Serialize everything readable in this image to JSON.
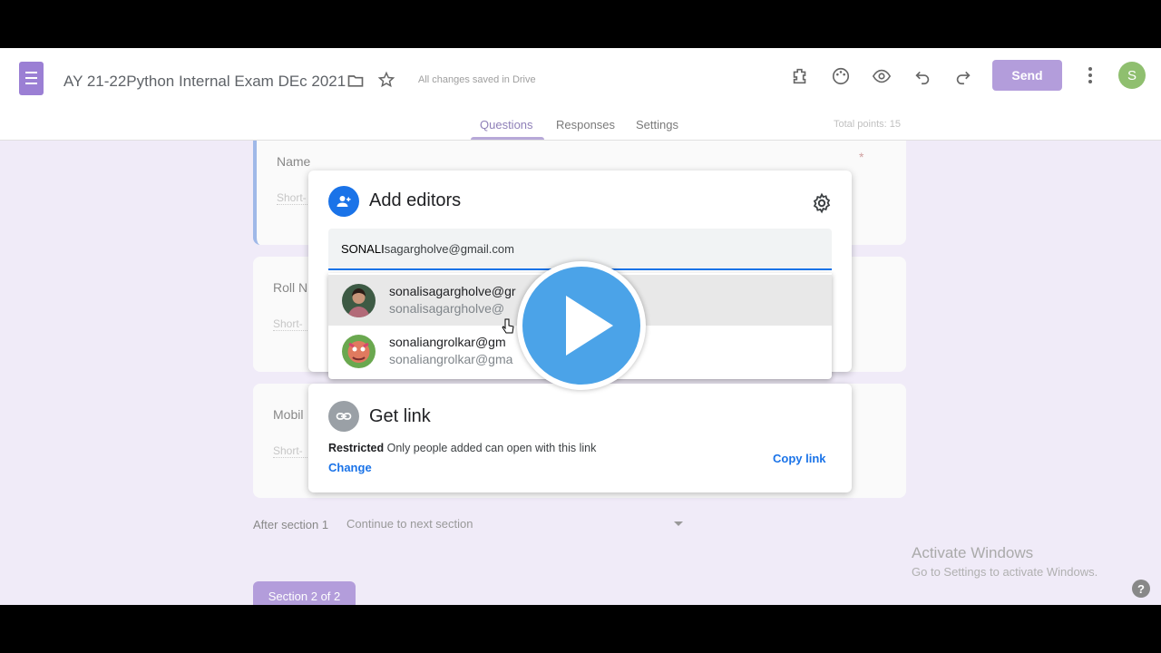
{
  "header": {
    "doc_title": "AY 21-22Python Internal Exam DEc 2021",
    "saved_status": "All changes saved in Drive",
    "send_label": "Send",
    "avatar_letter": "S",
    "total_points": "Total points: 15"
  },
  "tabs": [
    {
      "label": "Questions",
      "active": true
    },
    {
      "label": "Responses",
      "active": false
    },
    {
      "label": "Settings",
      "active": false
    }
  ],
  "form": {
    "questions": [
      {
        "title": "Name",
        "placeholder": "Short-"
      },
      {
        "title": "Roll N",
        "placeholder": "Short-"
      },
      {
        "title": "Mobil",
        "placeholder": "Short-"
      }
    ],
    "required_mark": "*",
    "after_section_label": "After section 1",
    "after_section_value": "Continue to next section",
    "section_pill": "Section 2 of 2"
  },
  "add_editors": {
    "title": "Add editors",
    "typed_bold": "SONALI",
    "typed_rest": "sagargholve@gmail.com",
    "suggestions": [
      {
        "name": "sonalisagargholve@gr",
        "email": "sonalisagargholve@",
        "highlighted": true
      },
      {
        "name": "sonaliangrolkar@gm",
        "email": "sonaliangrolkar@gma",
        "highlighted": false
      }
    ]
  },
  "get_link": {
    "title": "Get link",
    "restricted_label": "Restricted",
    "restricted_desc": "Only people added can open with this link",
    "change_label": "Change",
    "copy_label": "Copy link"
  },
  "watermark": {
    "line1": "Activate Windows",
    "line2": "Go to Settings to activate Windows."
  },
  "help_glyph": "?",
  "colors": {
    "accent_purple": "#b39ddb",
    "google_blue": "#1a73e8",
    "play_blue": "#4ba3e8"
  }
}
